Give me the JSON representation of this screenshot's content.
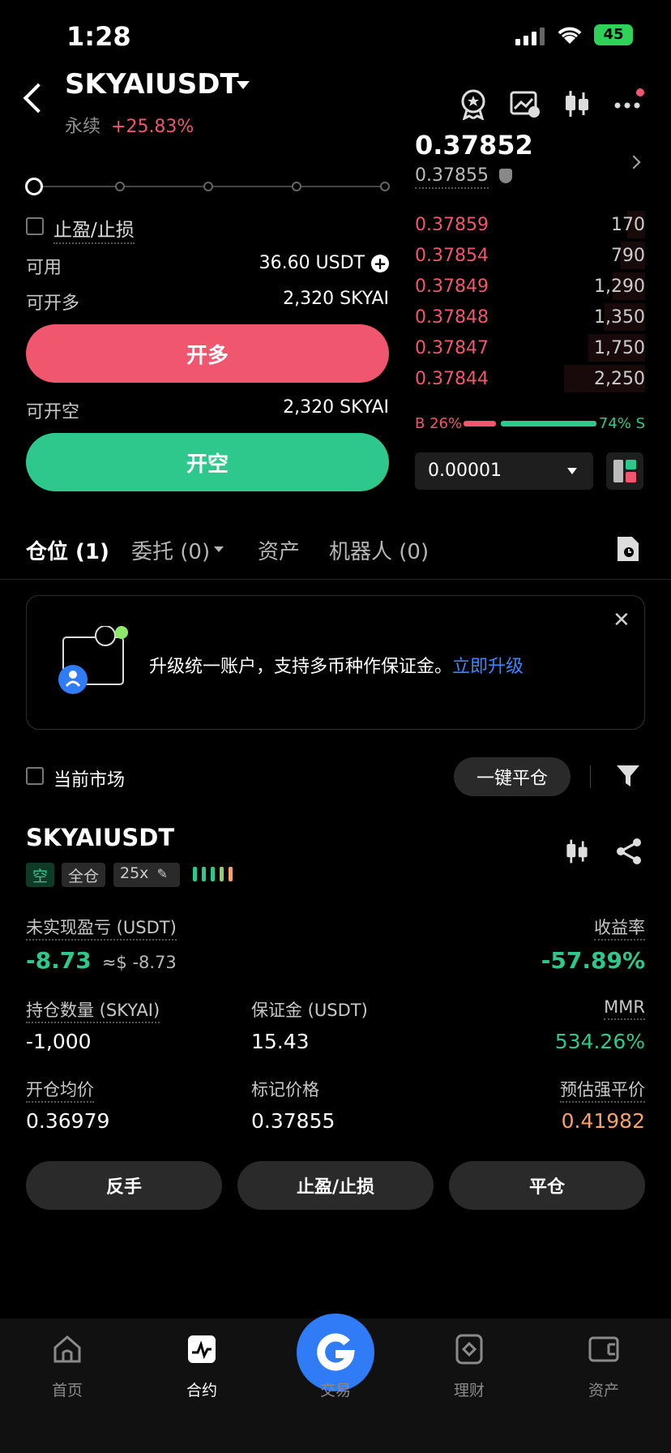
{
  "status": {
    "time": "1:28",
    "battery": "45"
  },
  "header": {
    "symbol": "SKYAIUSDT",
    "type": "永续",
    "change": "+25.83%"
  },
  "order_form": {
    "tpsl_label": "止盈/止损",
    "available_label": "可用",
    "available_value": "36.60 USDT",
    "max_long_label": "可开多",
    "max_long_value": "2,320 SKYAI",
    "long_button": "开多",
    "max_short_label": "可开空",
    "max_short_value": "2,320 SKYAI",
    "short_button": "开空"
  },
  "order_book": {
    "last_price": "0.37852",
    "mark_price": "0.37855",
    "asks": [
      {
        "price": "0.37859",
        "qty": "170"
      },
      {
        "price": "0.37854",
        "qty": "790"
      },
      {
        "price": "0.37849",
        "qty": "1,290"
      },
      {
        "price": "0.37848",
        "qty": "1,350"
      },
      {
        "price": "0.37847",
        "qty": "1,750"
      },
      {
        "price": "0.37844",
        "qty": "2,250"
      }
    ],
    "buy_ratio": "B 26%",
    "sell_ratio": "74% S",
    "buy_fraction": 0.26,
    "tick_size": "0.00001"
  },
  "tabs": [
    {
      "label": "仓位 (1)"
    },
    {
      "label": "委托 (0)"
    },
    {
      "label": "资产"
    },
    {
      "label": "机器人 (0)"
    }
  ],
  "banner": {
    "text": "升级统一账户，支持多币种作保证金。",
    "link": "立即升级"
  },
  "filter": {
    "current_market": "当前市场",
    "close_all": "一键平仓"
  },
  "position": {
    "symbol": "SKYAIUSDT",
    "side": "空",
    "margin_mode": "全仓",
    "leverage": "25x",
    "upnl_label": "未实现盈亏 (USDT)",
    "upnl_value": "-8.73",
    "upnl_usd": "≈$ -8.73",
    "roe_label": "收益率",
    "roe_value": "-57.89%",
    "size_label": "持仓数量 (SKYAI)",
    "size_value": "-1,000",
    "margin_label": "保证金 (USDT)",
    "margin_value": "15.43",
    "mmr_label": "MMR",
    "mmr_value": "534.26%",
    "entry_label": "开仓均价",
    "entry_value": "0.36979",
    "mark_label": "标记价格",
    "mark_value": "0.37855",
    "liq_label": "预估强平价",
    "liq_value": "0.41982",
    "reverse_btn": "反手",
    "tpsl_btn": "止盈/止损",
    "close_btn": "平仓"
  },
  "nav": [
    {
      "label": "首页"
    },
    {
      "label": "合约"
    },
    {
      "label": "交易"
    },
    {
      "label": "理财"
    },
    {
      "label": "资产"
    }
  ]
}
